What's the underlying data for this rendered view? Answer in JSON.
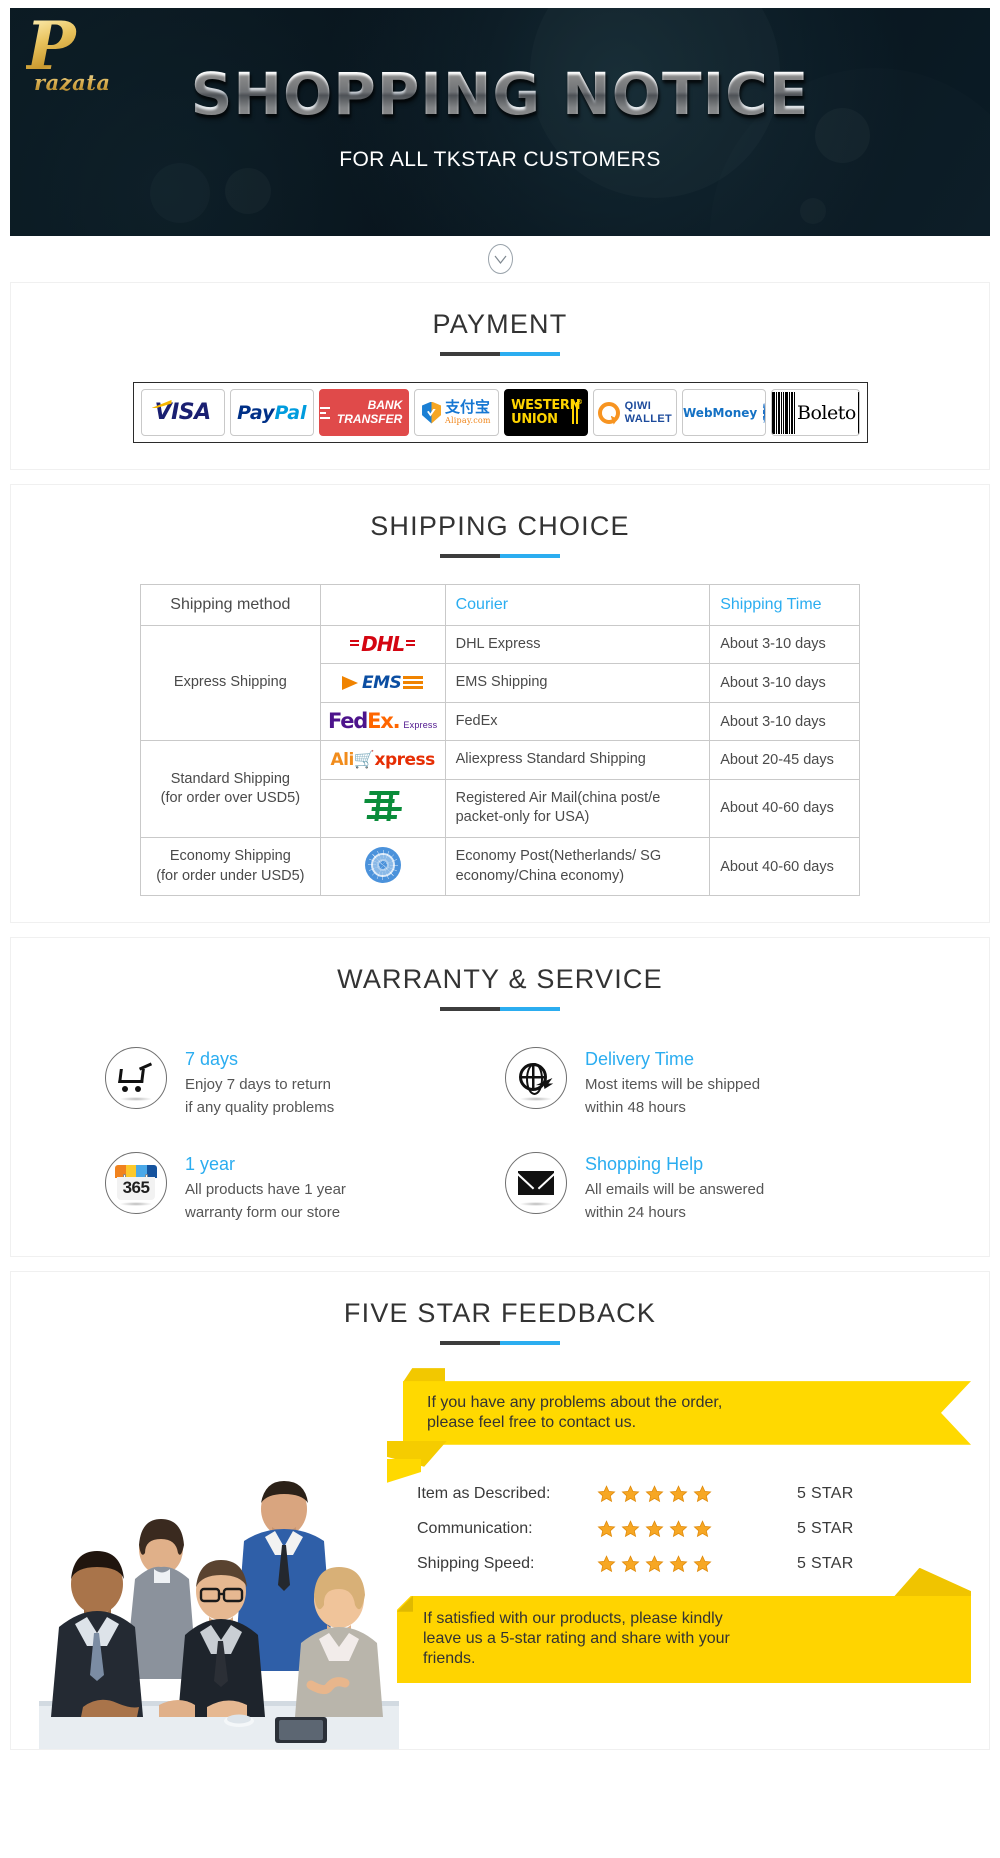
{
  "hero": {
    "logo_mark": "P",
    "logo_name": "razata",
    "title": "SHOPPING NOTICE",
    "subtitle": "FOR ALL TKSTAR CUSTOMERS"
  },
  "scroll_hint": {
    "icon": "chevron-down-icon"
  },
  "payment": {
    "title": "PAYMENT",
    "methods": [
      {
        "name": "visa",
        "label": "VISA"
      },
      {
        "name": "paypal",
        "label": "PayPal",
        "part1": "Pay",
        "part2": "Pal"
      },
      {
        "name": "bank-transfer",
        "line1": "BANK",
        "line2": "TRANSFER"
      },
      {
        "name": "alipay",
        "label": "支付宝",
        "domain": "Alipay.com"
      },
      {
        "name": "western-union",
        "line1": "WESTERN",
        "line2": "UNION"
      },
      {
        "name": "qiwi-wallet",
        "line1": "QIWI",
        "line2": "WALLET"
      },
      {
        "name": "webmoney",
        "label": "WebMoney"
      },
      {
        "name": "boleto",
        "label": "Boleto"
      }
    ]
  },
  "shipping": {
    "title": "SHIPPING CHOICE",
    "columns": [
      "Shipping method",
      "",
      "Courier",
      "Shipping Time"
    ],
    "groups": [
      {
        "method": "Express Shipping",
        "rows": [
          {
            "logo": "dhl-logo",
            "courier": "DHL Express",
            "time": "About 3-10 days"
          },
          {
            "logo": "ems-logo",
            "courier": "EMS Shipping",
            "time": "About 3-10 days"
          },
          {
            "logo": "fedex-logo",
            "courier": "FedEx",
            "time": "About 3-10 days"
          }
        ]
      },
      {
        "method": "Standard Shipping\n(for order over USD5)",
        "method_line1": "Standard Shipping",
        "method_line2": "(for order over USD5)",
        "rows": [
          {
            "logo": "aliexpress-logo",
            "courier": "Aliexpress Standard Shipping",
            "time": "About 20-45 days"
          },
          {
            "logo": "china-post-logo",
            "courier": "Registered Air Mail(china post/e packet-only for USA)",
            "time": "About 40-60 days"
          }
        ]
      },
      {
        "method_line1": "Economy Shipping",
        "method_line2": "(for order under USD5)",
        "rows": [
          {
            "logo": "un-post-logo",
            "courier": "Economy Post(Netherlands/ SG economy/China economy)",
            "time": "About 40-60 days"
          }
        ]
      }
    ]
  },
  "warranty": {
    "title": "WARRANTY & SERVICE",
    "items": [
      {
        "icon": "shopping-cart-icon",
        "title": "7  days",
        "desc_line1": "Enjoy 7 days to return",
        "desc_line2": "if any quality problems"
      },
      {
        "icon": "globe-plane-icon",
        "title": "Delivery Time",
        "desc_line1": "Most items will be shipped",
        "desc_line2": "within 48 hours"
      },
      {
        "icon": "calendar-365-icon",
        "title": "1 year",
        "desc_line1": "All products have 1 year",
        "desc_line2": "warranty form our store",
        "badge": "365"
      },
      {
        "icon": "envelope-icon",
        "title": "Shopping Help",
        "desc_line1": "All emails will be answered",
        "desc_line2": "within 24 hours"
      }
    ]
  },
  "feedback": {
    "title": "FIVE STAR FEEDBACK",
    "top_banner_line1": "If you have any problems about the order,",
    "top_banner_line2": "please feel free to contact us.",
    "ratings": [
      {
        "label": "Item as Described:",
        "stars": 5,
        "value": "5 STAR"
      },
      {
        "label": "Communication:",
        "stars": 5,
        "value": "5 STAR"
      },
      {
        "label": "Shipping Speed:",
        "stars": 5,
        "value": "5 STAR"
      }
    ],
    "bottom_banner_line1": "If satisfied with our products, please kindly",
    "bottom_banner_line2": "leave us a 5-star rating and share with your",
    "bottom_banner_line3": "friends.",
    "photo_alt": "business-team-photo"
  },
  "colors": {
    "accent_blue": "#2badf0",
    "rule_dark": "#3d3d3d",
    "banner_yellow": "#ffd900",
    "star_gold": "#f6a623",
    "hero_bg": "#071119"
  }
}
